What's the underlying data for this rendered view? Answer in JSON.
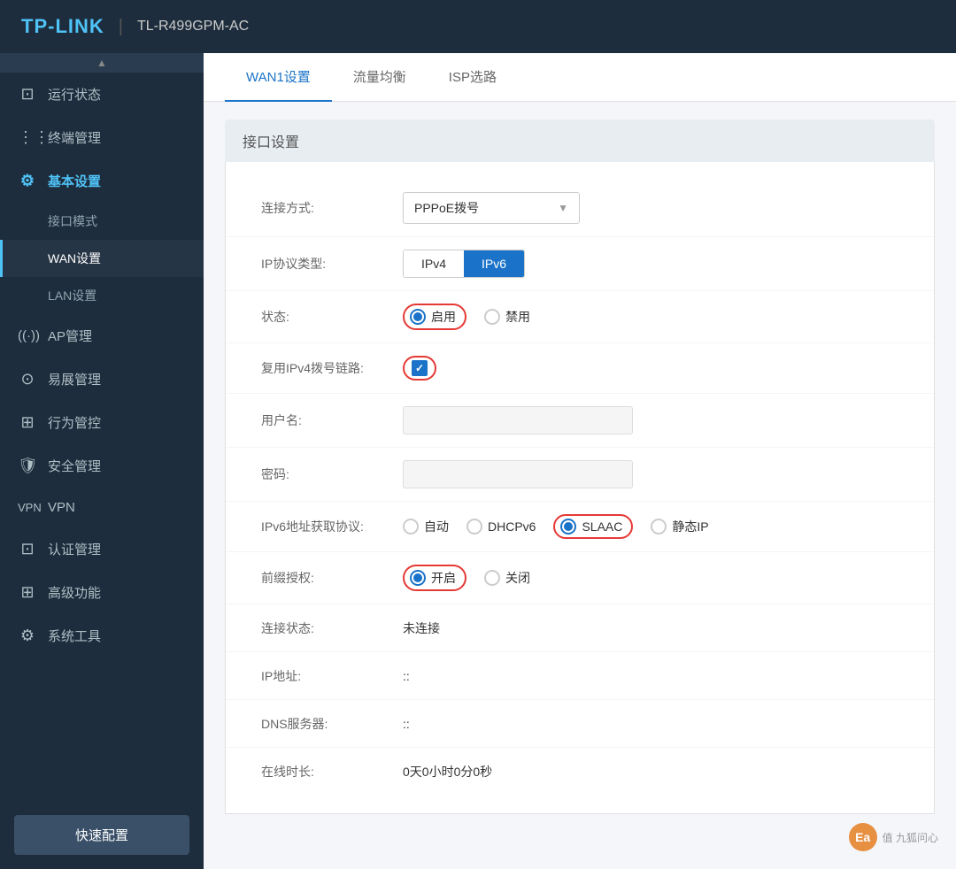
{
  "header": {
    "logo": "TP-LINK",
    "divider": "|",
    "device": "TL-R499GPM-AC"
  },
  "sidebar": {
    "scroll_indicator": "▲",
    "items": [
      {
        "id": "status",
        "icon": "⊡",
        "label": "运行状态",
        "active": false
      },
      {
        "id": "terminal",
        "icon": "⋮",
        "label": "终端管理",
        "active": false
      },
      {
        "id": "basic",
        "icon": "⚙",
        "label": "基本设置",
        "active": true
      }
    ],
    "sub_items": [
      {
        "id": "port-mode",
        "label": "接口模式",
        "active": false
      },
      {
        "id": "wan-settings",
        "label": "WAN设置",
        "active": true
      },
      {
        "id": "lan-settings",
        "label": "LAN设置",
        "active": false
      }
    ],
    "more_items": [
      {
        "id": "ap",
        "icon": "((·))",
        "label": "AP管理"
      },
      {
        "id": "easy-expand",
        "icon": "⊙",
        "label": "易展管理"
      },
      {
        "id": "behavior",
        "icon": "⊞",
        "label": "行为管控"
      },
      {
        "id": "security",
        "icon": "🛡",
        "label": "安全管理"
      },
      {
        "id": "vpn",
        "icon": "☁",
        "label": "VPN"
      },
      {
        "id": "auth",
        "icon": "⊡",
        "label": "认证管理"
      },
      {
        "id": "advanced",
        "icon": "⊞",
        "label": "高级功能"
      },
      {
        "id": "tools",
        "icon": "⚙",
        "label": "系统工具"
      }
    ],
    "quick_config": "快速配置"
  },
  "tabs": [
    {
      "id": "wan1",
      "label": "WAN1设置",
      "active": true
    },
    {
      "id": "balance",
      "label": "流量均衡",
      "active": false
    },
    {
      "id": "isp",
      "label": "ISP选路",
      "active": false
    }
  ],
  "section": {
    "title": "接口设置"
  },
  "form": {
    "connection_type": {
      "label": "连接方式:",
      "value": "PPPoE拨号"
    },
    "ip_protocol": {
      "label": "IP协议类型:",
      "options": [
        {
          "id": "ipv4",
          "label": "IPv4",
          "active": false
        },
        {
          "id": "ipv6",
          "label": "IPv6",
          "active": true
        }
      ]
    },
    "status": {
      "label": "状态:",
      "options": [
        {
          "id": "enable",
          "label": "启用",
          "checked": true
        },
        {
          "id": "disable",
          "label": "禁用",
          "checked": false
        }
      ]
    },
    "reuse_ipv4": {
      "label": "复用IPv4拨号链路:",
      "checked": true
    },
    "username": {
      "label": "用户名:",
      "placeholder": ""
    },
    "password": {
      "label": "密码:",
      "placeholder": ""
    },
    "ipv6_protocol": {
      "label": "IPv6地址获取协议:",
      "options": [
        {
          "id": "auto",
          "label": "自动",
          "checked": false
        },
        {
          "id": "dhcpv6",
          "label": "DHCPv6",
          "checked": false
        },
        {
          "id": "slaac",
          "label": "SLAAC",
          "checked": true
        },
        {
          "id": "static",
          "label": "静态IP",
          "checked": false
        }
      ]
    },
    "prefix_auth": {
      "label": "前缀授权:",
      "options": [
        {
          "id": "on",
          "label": "开启",
          "checked": true
        },
        {
          "id": "off",
          "label": "关闭",
          "checked": false
        }
      ]
    },
    "connection_status": {
      "label": "连接状态:",
      "value": "未连接"
    },
    "ip_address": {
      "label": "IP地址:",
      "value": "::"
    },
    "dns": {
      "label": "DNS服务器:",
      "value": "::"
    },
    "online_time": {
      "label": "在线时长:",
      "value": "0天0小时0分0秒"
    }
  },
  "watermark": {
    "site": "值 九狐问心",
    "logo_text": "Ea"
  }
}
